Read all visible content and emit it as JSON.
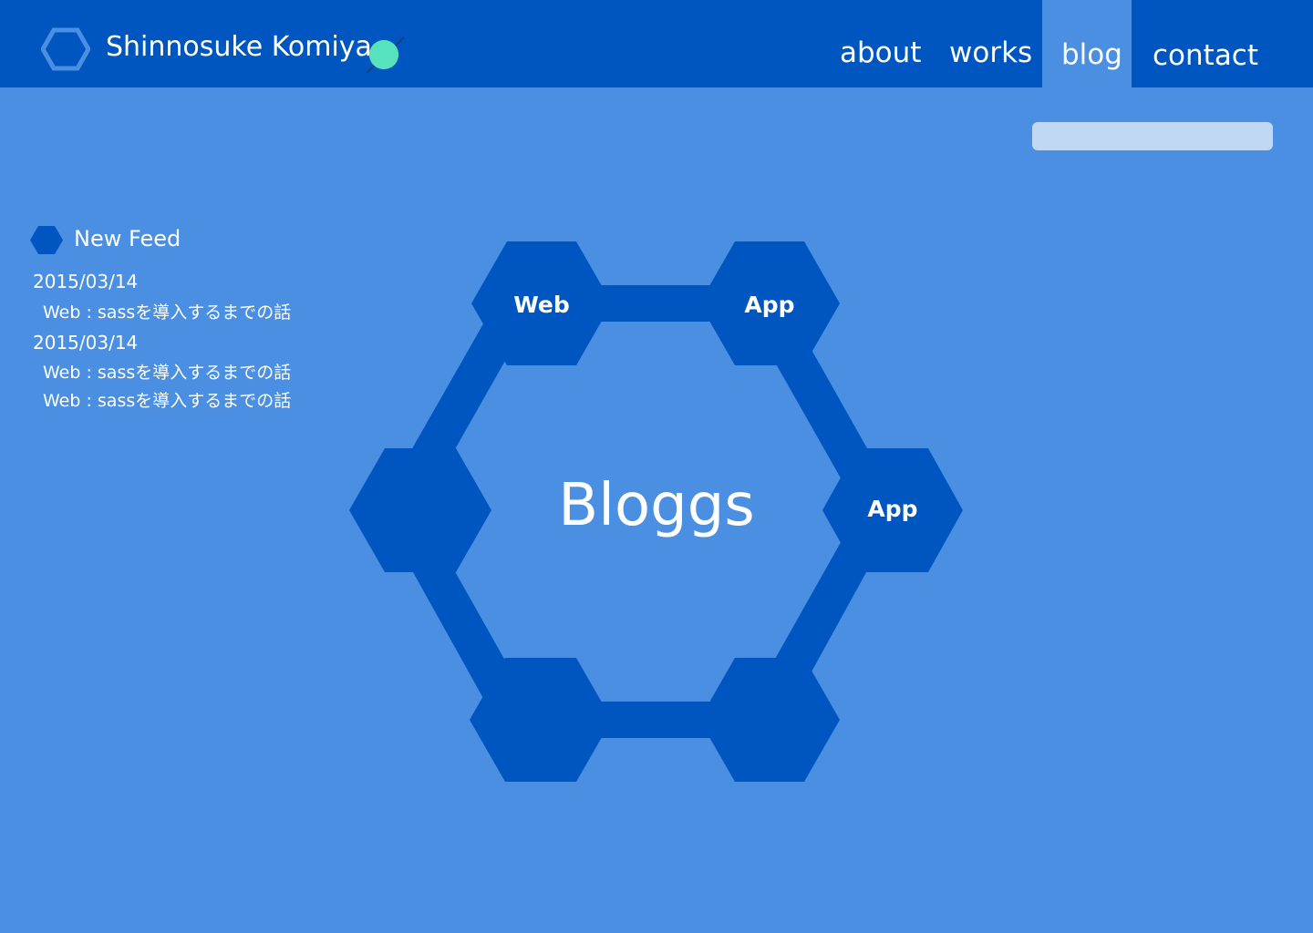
{
  "colors": {
    "header_bg": "#0056c0",
    "page_bg": "#4a8fe2",
    "accent_dot": "#56e2bc",
    "search_bg": "#c1d8f4",
    "text": "#ffffff"
  },
  "header": {
    "title": "Shinnosuke Komiya",
    "logo_icon": "hexagon-outline-icon",
    "status_icon": "green-dot-icon"
  },
  "nav": {
    "items": [
      {
        "label": "about",
        "active": false
      },
      {
        "label": "works",
        "active": false
      },
      {
        "label": "blog",
        "active": true
      },
      {
        "label": "contact",
        "active": false
      }
    ]
  },
  "search": {
    "value": "",
    "placeholder": ""
  },
  "feed": {
    "icon": "hexagon-icon",
    "title": "New Feed",
    "entries": [
      {
        "date": "2015/03/14",
        "posts": [
          "Web : sassを導入するまでの話"
        ]
      },
      {
        "date": "2015/03/14",
        "posts": [
          "Web : sassを導入するまでの話",
          "Web : sassを導入するまでの話"
        ]
      }
    ]
  },
  "hex_menu": {
    "center_label": "Bloggs",
    "nodes": [
      {
        "label": "Web"
      },
      {
        "label": "App"
      },
      {
        "label": "App"
      },
      {
        "label": ""
      },
      {
        "label": ""
      },
      {
        "label": ""
      }
    ]
  }
}
